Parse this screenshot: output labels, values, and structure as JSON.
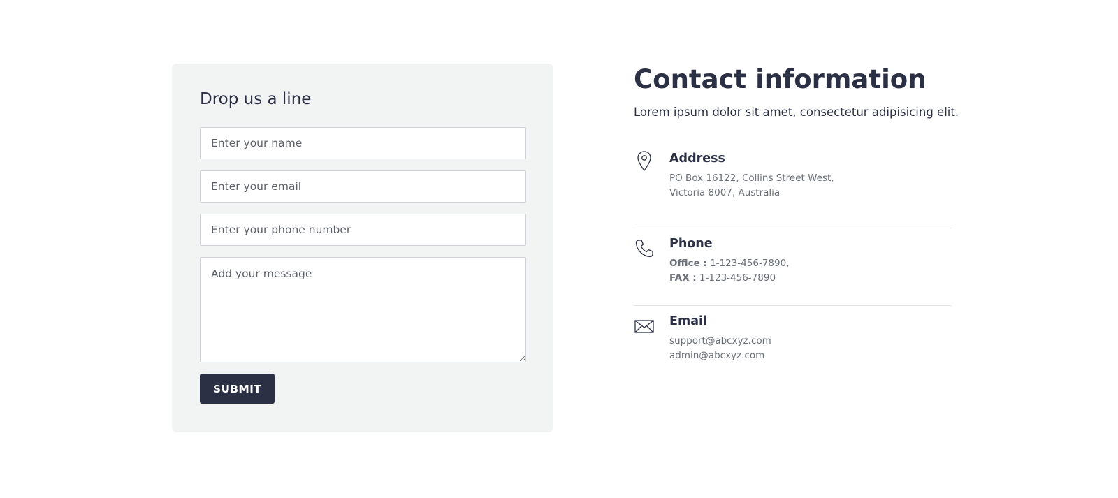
{
  "form": {
    "title": "Drop us a line",
    "name_placeholder": "Enter your name",
    "email_placeholder": "Enter your email",
    "phone_placeholder": "Enter your phone number",
    "message_placeholder": "Add your message",
    "submit_label": "SUBMIT"
  },
  "contact": {
    "title": "Contact information",
    "description": "Lorem ipsum dolor sit amet, consectetur adipisicing elit.",
    "address": {
      "icon": "map-pin-icon",
      "heading": "Address",
      "line1": "PO Box 16122, Collins Street West,",
      "line2": "Victoria 8007, Australia"
    },
    "phone": {
      "icon": "phone-icon",
      "heading": "Phone",
      "office_label": "Office :",
      "office_value": "1-123-456-7890,",
      "fax_label": "FAX :",
      "fax_value": "1-123-456-7890"
    },
    "email": {
      "icon": "envelope-icon",
      "heading": "Email",
      "line1": "support@abcxyz.com",
      "line2": "admin@abcxyz.com"
    }
  },
  "colors": {
    "primary": "#2b3044",
    "card_background": "#f2f4f4",
    "muted_text": "#6b7079"
  }
}
